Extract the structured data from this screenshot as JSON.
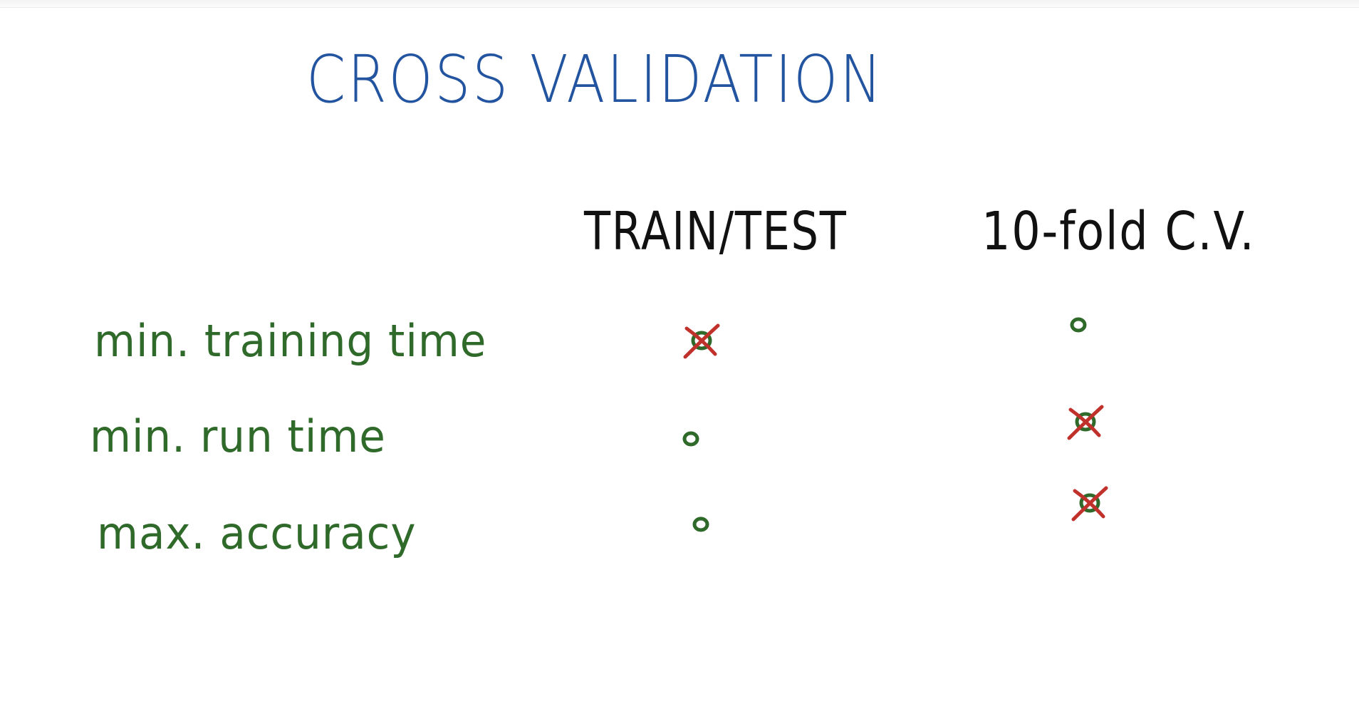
{
  "title": "CROSS VALIDATION",
  "columns": [
    "TRAIN/TEST",
    "10-fold C.V."
  ],
  "rows": [
    {
      "label": "min. training time",
      "marks": [
        "crossed",
        "open"
      ]
    },
    {
      "label": "min. run time",
      "marks": [
        "open",
        "crossed"
      ]
    },
    {
      "label": "max. accuracy",
      "marks": [
        "open",
        "crossed"
      ]
    }
  ],
  "colors": {
    "title": "#2354a0",
    "header": "#111111",
    "labels": "#2f6a2a",
    "circle": "#2f6a2a",
    "cross": "#c0312b"
  }
}
